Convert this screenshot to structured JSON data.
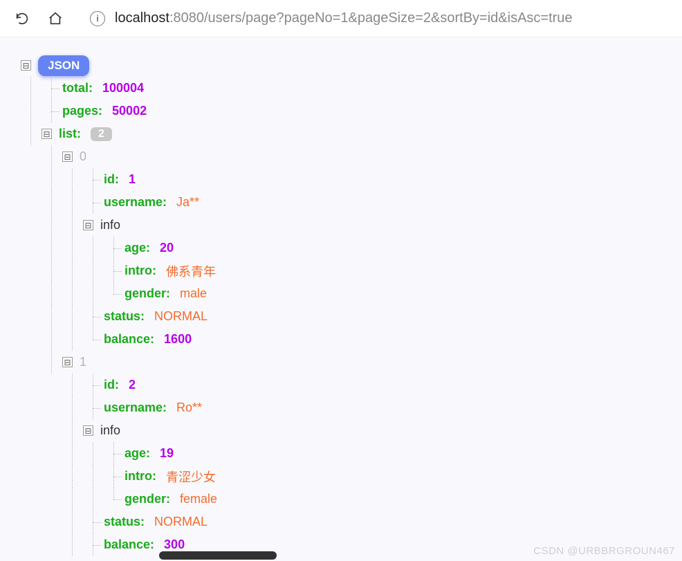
{
  "url": {
    "host": "localhost",
    "rest": ":8080/users/page?pageNo=1&pageSize=2&sortBy=id&isAsc=true"
  },
  "root_label": "JSON",
  "keys": {
    "total": "total",
    "pages": "pages",
    "list": "list",
    "id": "id",
    "username": "username",
    "info": "info",
    "age": "age",
    "intro": "intro",
    "gender": "gender",
    "status": "status",
    "balance": "balance"
  },
  "values": {
    "total": "100004",
    "pages": "50002",
    "list_count": "2",
    "idx0": "0",
    "idx1": "1"
  },
  "list": [
    {
      "id": "1",
      "username": "Ja**",
      "info": {
        "age": "20",
        "intro": "佛系青年",
        "gender": "male"
      },
      "status": "NORMAL",
      "balance": "1600"
    },
    {
      "id": "2",
      "username": "Ro**",
      "info": {
        "age": "19",
        "intro": "青涩少女",
        "gender": "female"
      },
      "status": "NORMAL",
      "balance": "300"
    }
  ],
  "watermark": "CSDN @URBBRGROUN467"
}
